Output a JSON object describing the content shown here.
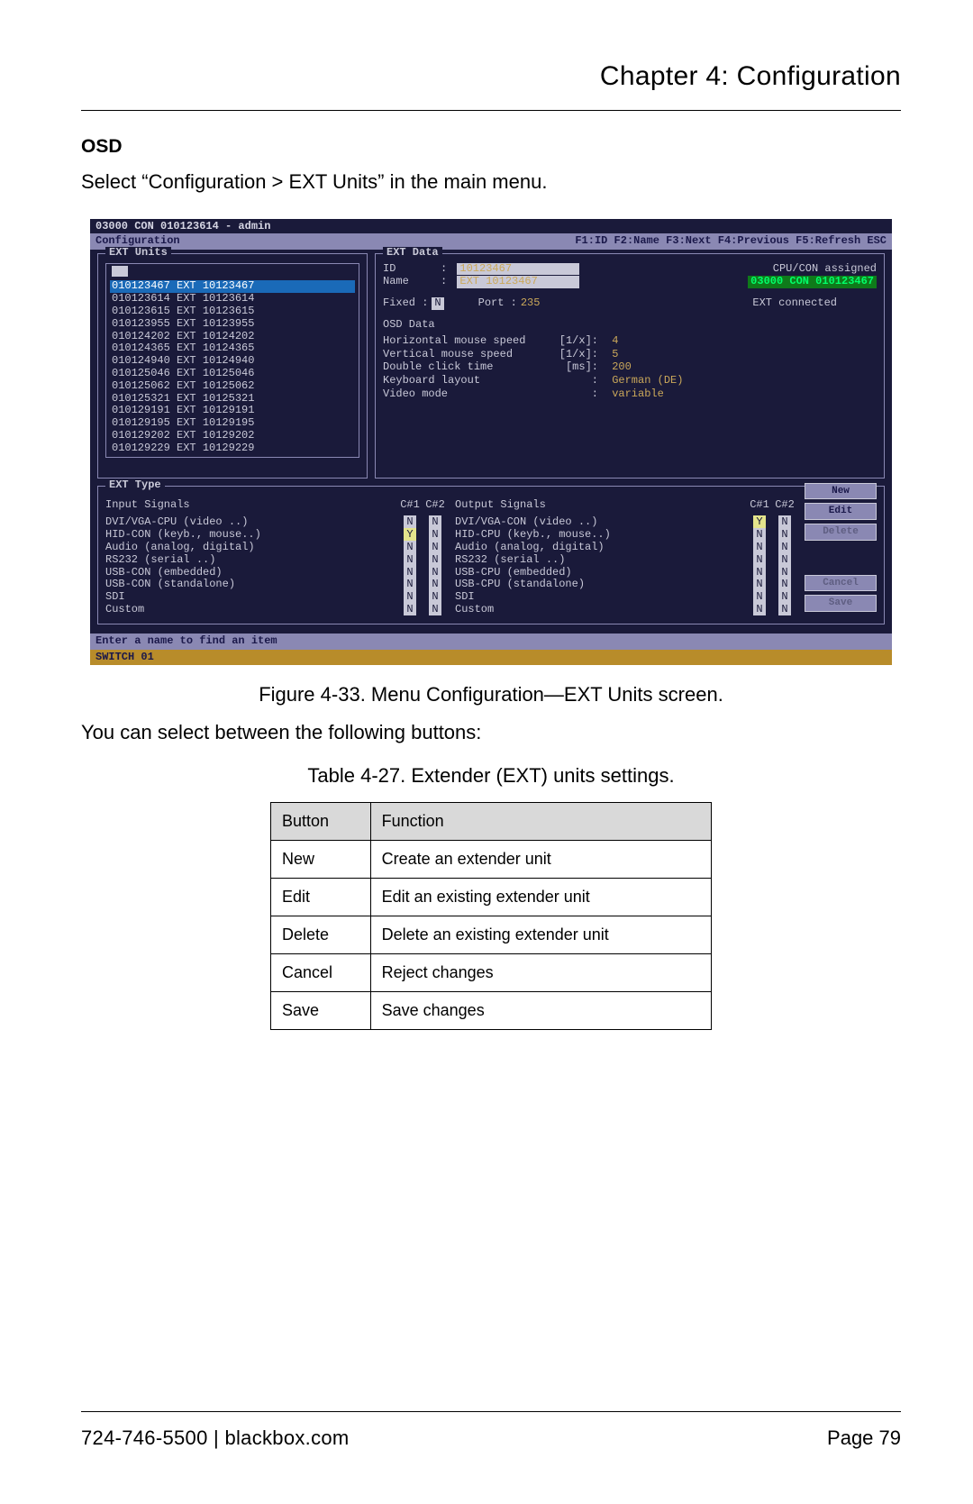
{
  "header": {
    "chapter": "Chapter 4: Configuration",
    "osd": "OSD",
    "instruction": "Select “Configuration > EXT Units” in the main menu."
  },
  "osd": {
    "title": "03000 CON 010123614 - admin",
    "menubar": {
      "left": "Configuration",
      "right": "F1:ID  F2:Name  F3:Next  F4:Previous  F5:Refresh  ESC"
    },
    "left_label": "EXT Units",
    "right_label": "EXT Data",
    "list_selected": "010123467 EXT 10123467",
    "list": [
      "010123614 EXT 10123614",
      "010123615 EXT 10123615",
      "010123955 EXT 10123955",
      "010124202 EXT 10124202",
      "010124365 EXT 10124365",
      "010124940 EXT 10124940",
      "010125046 EXT 10125046",
      "010125062 EXT 10125062",
      "010125321 EXT 10125321",
      "010129191 EXT 10129191",
      "010129195 EXT 10129195",
      "010129202 EXT 10129202",
      "010129229 EXT 10129229"
    ],
    "id_label": "ID",
    "id_val": "10123467",
    "name_label": "Name",
    "name_val": "EXT 10123467",
    "cpu_assigned": "CPU/CON assigned",
    "cpu_assigned_val": "03000 CON 010123467",
    "fixed_label": "Fixed :",
    "fixed_val": "N",
    "port_label": "Port :",
    "port_val": "235",
    "ext_conn": "EXT connected",
    "osd_data": "OSD Data",
    "hmouse": "Horizontal mouse speed",
    "hmouse_u": "[1/x]:",
    "hmouse_v": "4",
    "vmouse": "Vertical mouse speed",
    "vmouse_u": "[1/x]:",
    "vmouse_v": "5",
    "dclick": "Double click time",
    "dclick_u": "[ms]:",
    "dclick_v": "200",
    "kblayout": "Keyboard layout",
    "kblayout_v": "German (DE)",
    "vmode": "Video mode",
    "vmode_v": "variable",
    "type_label": "EXT Type",
    "in_hdr": "Input Signals",
    "out_hdr": "Output Signals",
    "c1": "C#1",
    "c2": "C#2",
    "in_rows": [
      {
        "n": "DVI/VGA-CPU (video ..)",
        "c1": "N",
        "c2": "N"
      },
      {
        "n": "HID-CON (keyb., mouse..)",
        "c1": "Y",
        "c2": "N"
      },
      {
        "n": "Audio (analog, digital)",
        "c1": "N",
        "c2": "N"
      },
      {
        "n": "RS232 (serial ..)",
        "c1": "N",
        "c2": "N"
      },
      {
        "n": "USB-CON (embedded)",
        "c1": "N",
        "c2": "N"
      },
      {
        "n": "USB-CON (standalone)",
        "c1": "N",
        "c2": "N"
      },
      {
        "n": "SDI",
        "c1": "N",
        "c2": "N"
      },
      {
        "n": "Custom",
        "c1": "N",
        "c2": "N"
      }
    ],
    "out_rows": [
      {
        "n": "DVI/VGA-CON (video ..)",
        "c1": "Y",
        "c2": "N"
      },
      {
        "n": "HID-CPU (keyb., mouse..)",
        "c1": "N",
        "c2": "N"
      },
      {
        "n": "Audio (analog, digital)",
        "c1": "N",
        "c2": "N"
      },
      {
        "n": "RS232 (serial ..)",
        "c1": "N",
        "c2": "N"
      },
      {
        "n": "USB-CPU (embedded)",
        "c1": "N",
        "c2": "N"
      },
      {
        "n": "USB-CPU (standalone)",
        "c1": "N",
        "c2": "N"
      },
      {
        "n": "SDI",
        "c1": "N",
        "c2": "N"
      },
      {
        "n": "Custom",
        "c1": "N",
        "c2": "N"
      }
    ],
    "btns": {
      "new": "New",
      "edit": "Edit",
      "delete": "Delete",
      "cancel": "Cancel",
      "save": "Save"
    },
    "hint": "Enter a name to find an item",
    "status": "SWITCH 01"
  },
  "figcap": "Figure 4-33. Menu Configuration—EXT Units screen.",
  "lead": "You can select between the following buttons:",
  "tblcap": "Table 4-27. Extender (EXT) units settings.",
  "table": {
    "h1": "Button",
    "h2": "Function",
    "rows": [
      {
        "b": "New",
        "f": "Create an extender unit"
      },
      {
        "b": "Edit",
        "f": "Edit an existing extender unit"
      },
      {
        "b": "Delete",
        "f": "Delete an existing extender unit"
      },
      {
        "b": "Cancel",
        "f": "Reject changes"
      },
      {
        "b": "Save",
        "f": "Save changes"
      }
    ]
  },
  "footer": {
    "left": "724-746-5500   |   blackbox.com",
    "right": "Page 79"
  }
}
